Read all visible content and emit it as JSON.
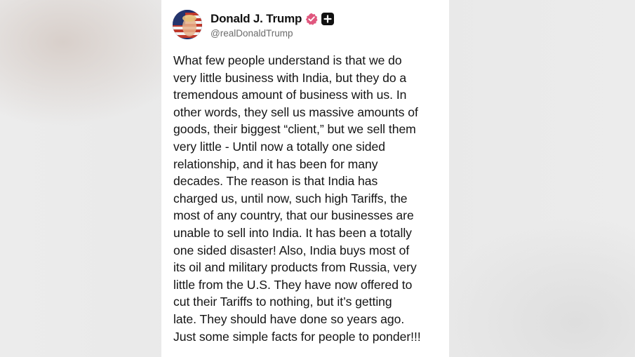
{
  "post": {
    "author": {
      "display_name": "Donald J. Trump",
      "handle": "@realDonaldTrump",
      "verified_icon": "verified-badge-icon",
      "badge_icon": "plus-icon"
    },
    "lines": [
      "What few people understand is that we do",
      "very little business with India, but they do a",
      "tremendous amount of business with us. In",
      "other words, they sell us massive amounts of",
      "goods, their biggest “client,” but we sell them",
      "very little - Until now a totally one sided",
      "relationship, and it has been for many",
      "decades. The reason is that India has",
      "charged us, until now, such high Tariffs, the",
      "most of any country, that our businesses are",
      "unable to sell into India. It has been a totally",
      "one sided disaster! Also, India buys most of",
      "its oil and military products from Russia, very",
      "little from the U.S. They have now offered to",
      "cut their Tariffs to nothing, but it’s getting",
      "late. They should have done so years ago.",
      "Just some simple facts for people to ponder!!!"
    ]
  },
  "colors": {
    "verified_badge": "#e0577e",
    "plus_badge": "#111111",
    "text": "#141414",
    "handle": "#6b6b6b",
    "background": "#e9e9e9",
    "card": "#ffffff"
  }
}
